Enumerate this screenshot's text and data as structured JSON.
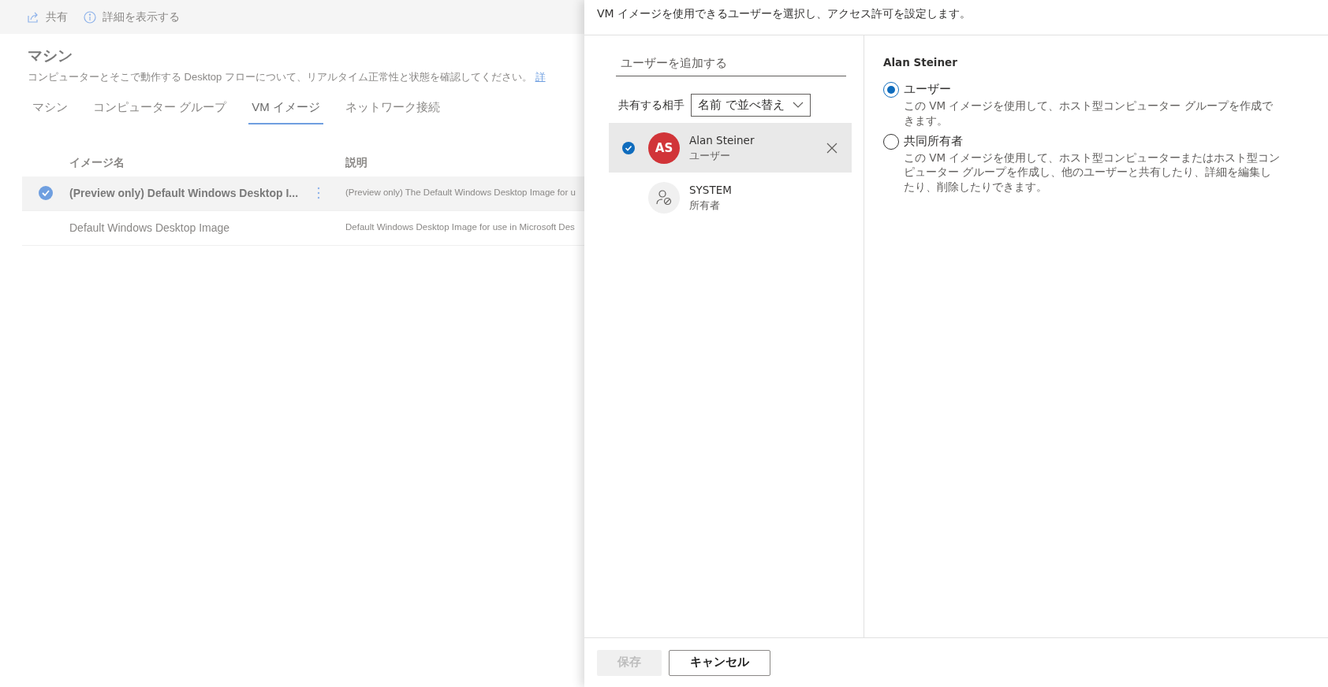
{
  "toolbar": [
    {
      "label": "共有",
      "kind": "share"
    },
    {
      "label": "詳細を表示する",
      "kind": "info"
    }
  ],
  "page": {
    "title": "マシン",
    "description": "コンピューターとそこで動作する Desktop フローについて、リアルタイム正常性と状態を確認してください。",
    "link": "詳"
  },
  "tabs": [
    {
      "label": "マシン",
      "selected": false
    },
    {
      "label": "コンピューター グループ",
      "selected": false
    },
    {
      "label": "VM イメージ",
      "selected": true
    },
    {
      "label": "ネットワーク接続",
      "selected": false
    }
  ],
  "table": {
    "columns": [
      "イメージ名",
      "説明"
    ],
    "rows": [
      {
        "name": "(Preview only) Default Windows Desktop I...",
        "description": "(Preview only) The Default Windows Desktop Image for u",
        "selected": true
      },
      {
        "name": "Default Windows Desktop Image",
        "description": "Default Windows Desktop Image for use in Microsoft Des",
        "selected": false
      }
    ]
  },
  "panel": {
    "heading": "VM イメージを使用できるユーザーを選択し、アクセス許可を設定します。",
    "add_user": {
      "placeholder": "ユーザーを追加する"
    },
    "share_with_label": "共有する相手",
    "sort": {
      "value": "名前 で並べ替え"
    },
    "users": [
      {
        "kind": "initials",
        "initials": "AS",
        "color": "#d13438",
        "name": "Alan Steiner",
        "role": "ユーザー",
        "selected": true
      },
      {
        "kind": "system",
        "name": "SYSTEM",
        "role": "所有者",
        "selected": false
      }
    ],
    "permissions": {
      "user": "Alan Steiner",
      "options": [
        {
          "label": "ユーザー",
          "description": "この VM イメージを使用して、ホスト型コンピューター グループを作成できます。",
          "selected": true
        },
        {
          "label": "共同所有者",
          "description": "この VM イメージを使用して、ホスト型コンピューターまたはホスト型コンピューター グループを作成し、他のユーザーと共有したり、詳細を編集したり、削除したりできます。",
          "selected": false
        }
      ]
    },
    "buttons": [
      {
        "kind": "primary",
        "label": "保存",
        "disabled": true
      },
      {
        "kind": "secondary",
        "label": "キャンセル",
        "disabled": false
      }
    ]
  }
}
